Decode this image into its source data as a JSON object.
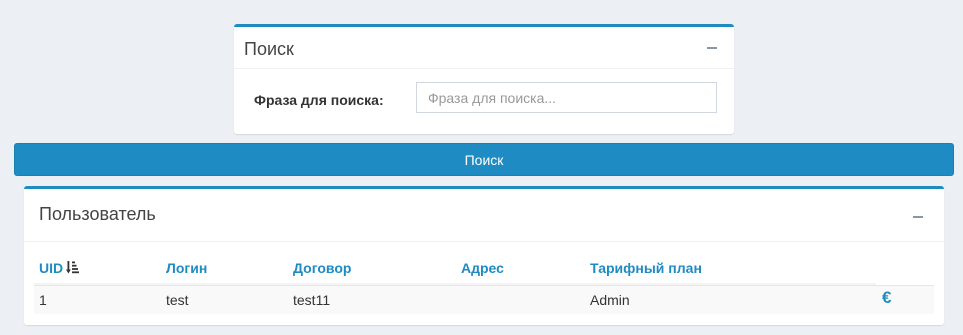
{
  "search_panel": {
    "title": "Поиск",
    "field_label": "Фраза для поиска:",
    "input_placeholder": "Фраза для поиска...",
    "input_value": ""
  },
  "search_button": {
    "label": "Поиск"
  },
  "users_panel": {
    "title": "Пользователь",
    "columns": [
      "UID",
      "Логин",
      "Договор",
      "Адрес",
      "Тарифный план"
    ],
    "rows": [
      {
        "uid": "1",
        "login": "test",
        "contract": "test11",
        "address": "",
        "tariff": "Admin",
        "action_icon": "€"
      }
    ]
  },
  "colors": {
    "accent": "#1e8bc3",
    "background": "#ecf0f5"
  },
  "icons": {
    "sort": "sort-amount-down-icon",
    "collapse": "minus-icon",
    "payment": "euro-icon"
  }
}
